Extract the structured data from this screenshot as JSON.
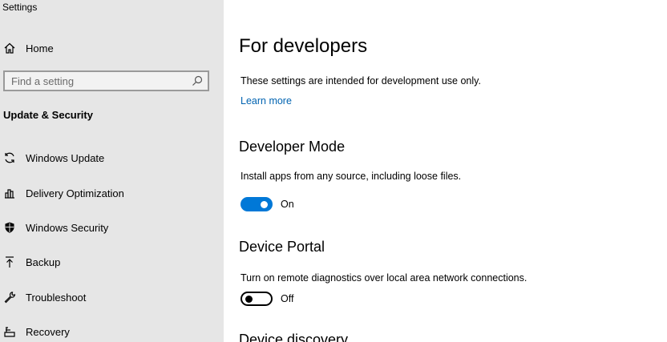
{
  "window": {
    "title": "Settings"
  },
  "sidebar": {
    "home_label": "Home",
    "search": {
      "placeholder": "Find a setting",
      "value": ""
    },
    "section_title": "Update & Security",
    "items": [
      {
        "label": "Windows Update",
        "icon": "refresh-icon"
      },
      {
        "label": "Delivery Optimization",
        "icon": "delivery-optimization-icon"
      },
      {
        "label": "Windows Security",
        "icon": "shield-icon"
      },
      {
        "label": "Backup",
        "icon": "backup-arrow-icon"
      },
      {
        "label": "Troubleshoot",
        "icon": "wrench-icon"
      },
      {
        "label": "Recovery",
        "icon": "recovery-icon"
      }
    ]
  },
  "main": {
    "title": "For developers",
    "intro": "These settings are intended for development use only.",
    "learn_more": "Learn more",
    "developer_mode": {
      "heading": "Developer Mode",
      "description": "Install apps from any source, including loose files.",
      "toggle_state": "On",
      "enabled": true
    },
    "device_portal": {
      "heading": "Device Portal",
      "description": "Turn on remote diagnostics over local area network connections.",
      "toggle_state": "Off",
      "enabled": false
    },
    "next_heading": "Device discovery"
  },
  "colors": {
    "accent": "#0078d7",
    "link": "#0063b1",
    "sidebar_bg": "#e6e6e6"
  }
}
